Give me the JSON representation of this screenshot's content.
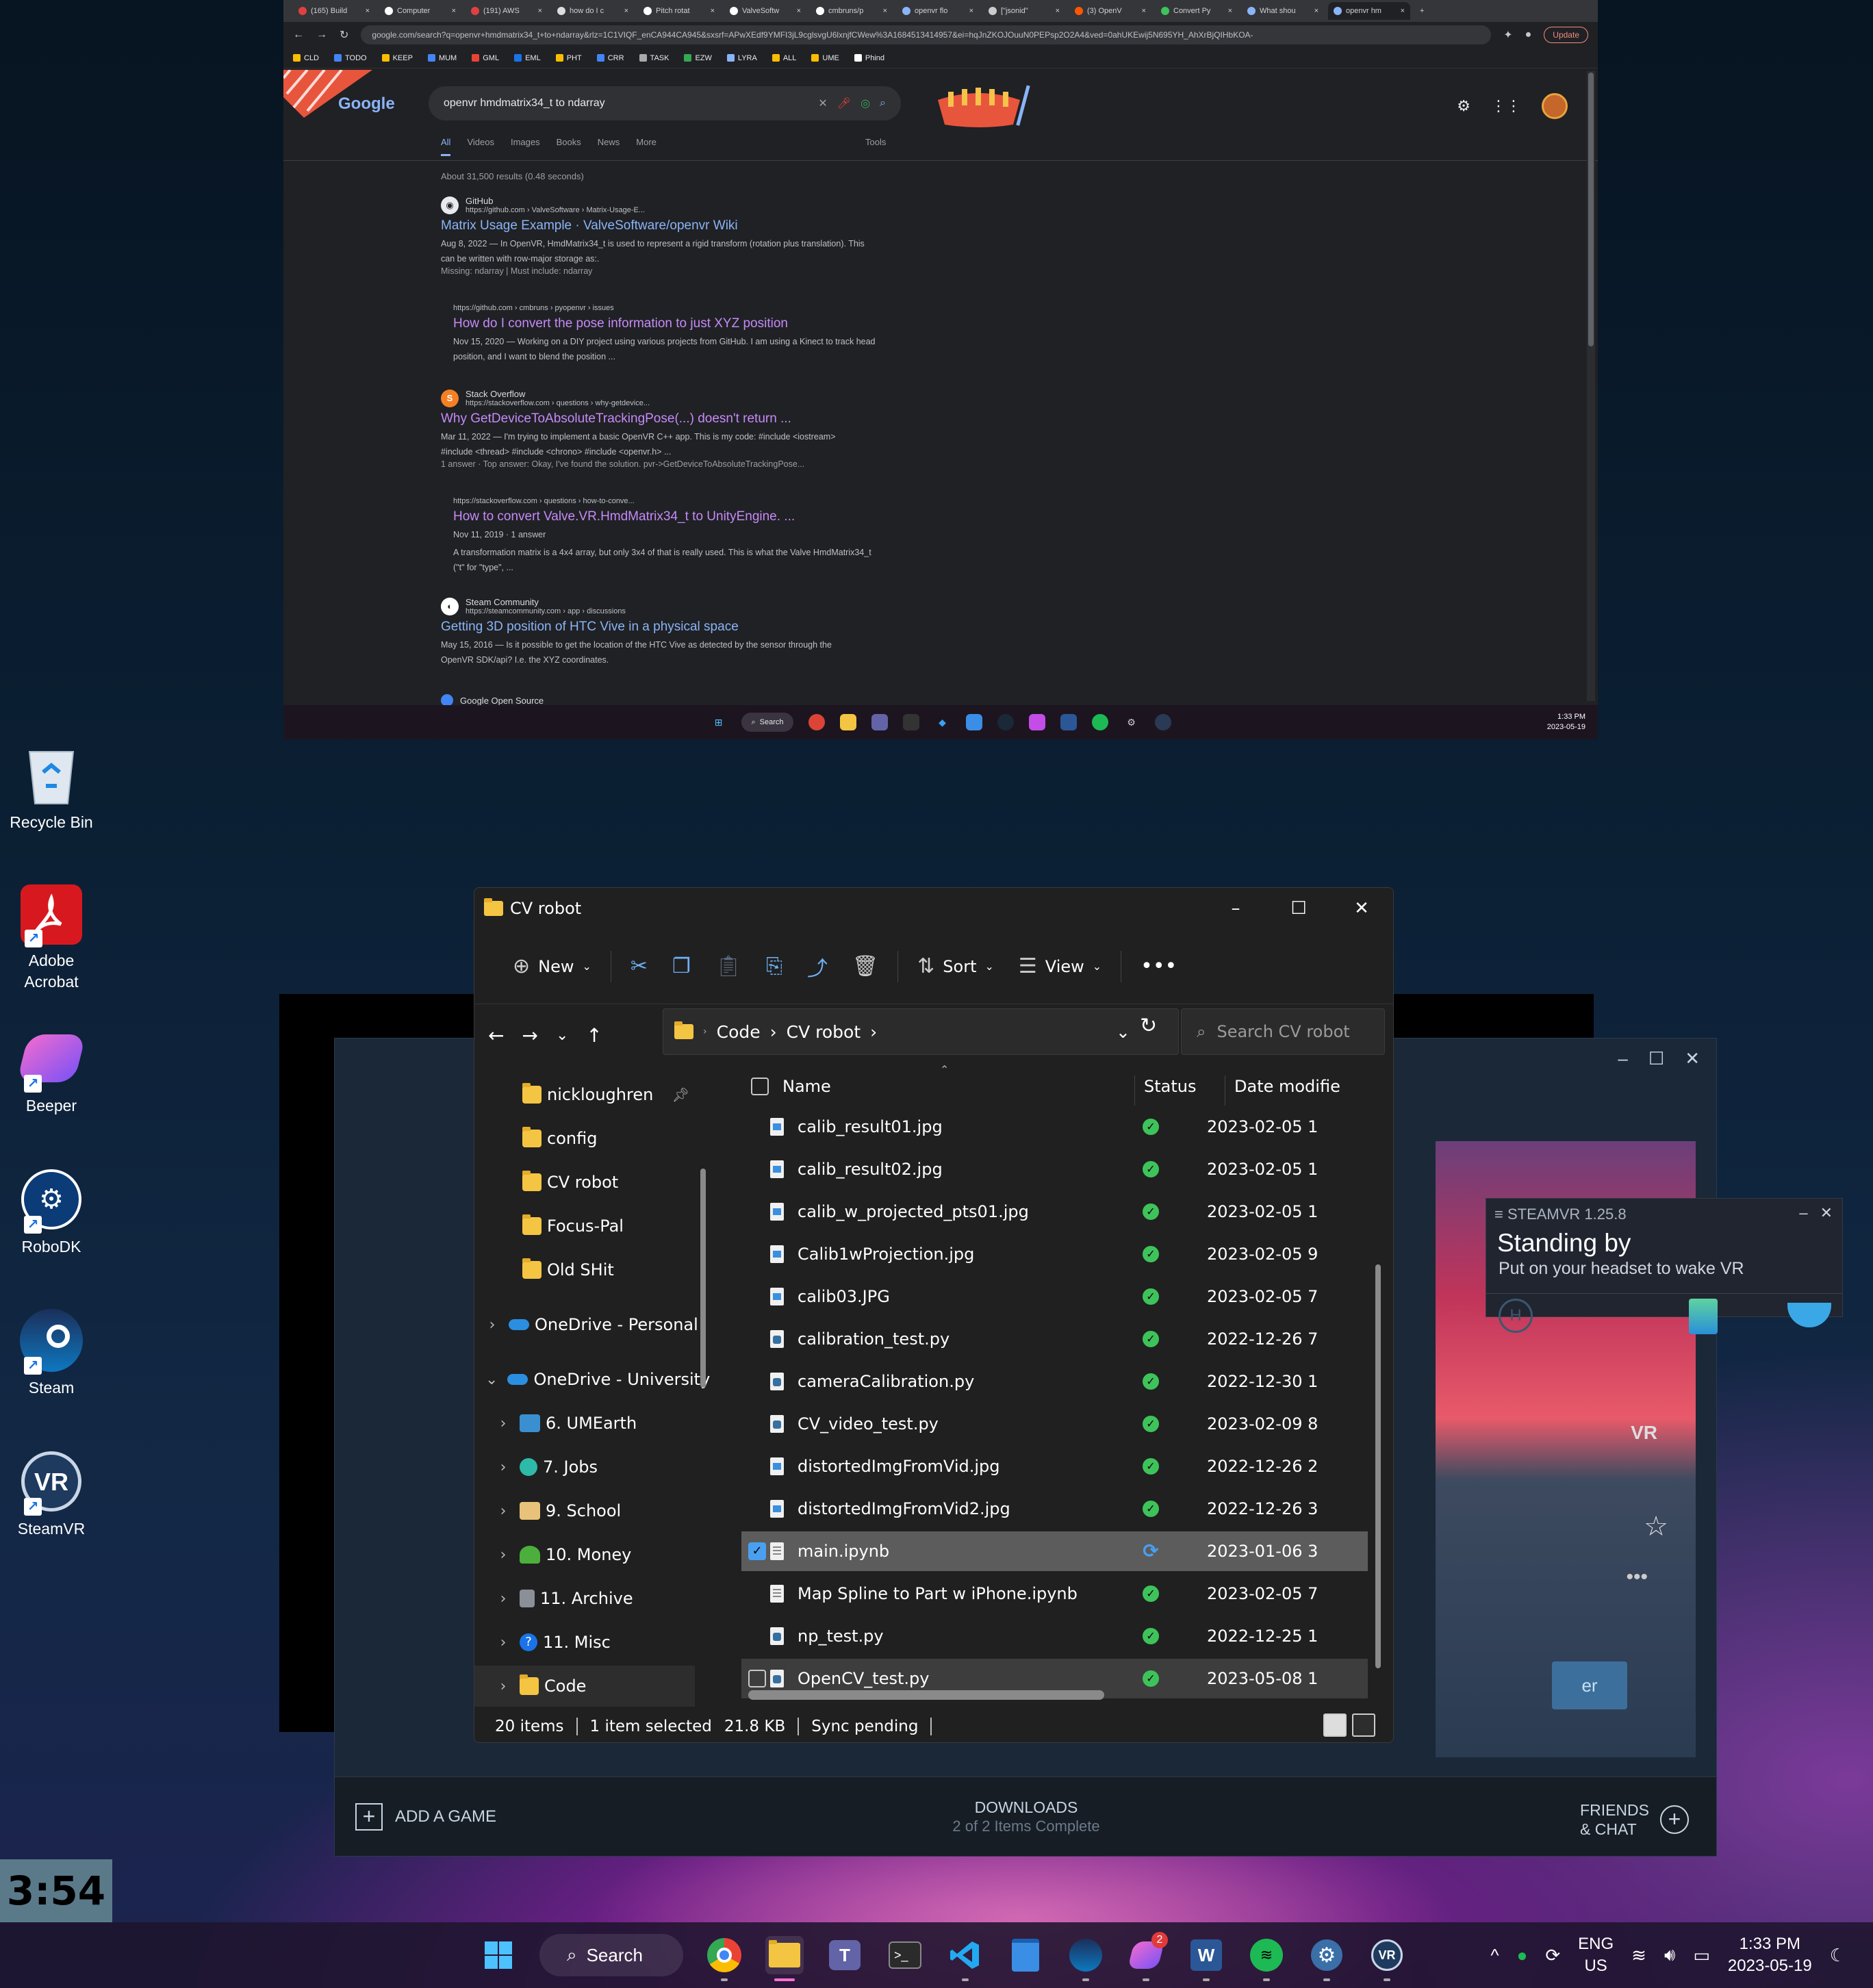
{
  "browser": {
    "tabs": [
      "(165) Build",
      "Computer",
      "(191) AWS",
      "how do I c",
      "Pitch rotat",
      "ValveSoftw",
      "cmbruns/p",
      "openvr flo",
      "[\"jsonid\"",
      "(3) OpenV",
      "Convert Py",
      "What shou",
      "openvr hm"
    ],
    "url": "google.com/search?q=openvr+hmdmatrix34_t+to+ndarray&rlz=1C1VIQF_enCA944CA945&sxsrf=APwXEdf9YMFI3jL9cglsvgU6lxnjfCWew%3A1684513414957&ei=hqJnZKOJOuuN0PEPsp2O2A4&ved=0ahUKEwij5N695YH_AhXrBjQIHbKOA-",
    "update_label": "Update",
    "bookmarks": [
      "CLD",
      "TODO",
      "KEEP",
      "MUM",
      "GML",
      "EML",
      "PHT",
      "CRR",
      "TASK",
      "EZW",
      "LYRA",
      "ALL",
      "UME",
      "Phind"
    ]
  },
  "google": {
    "logo": "Google",
    "query": "openvr hmdmatrix34_t to ndarray",
    "tabs": [
      "All",
      "Videos",
      "Images",
      "Books",
      "News",
      "More"
    ],
    "tools": "Tools",
    "stats": "About 31,500 results (0.48 seconds)",
    "results": [
      {
        "site": "GitHub",
        "url": "https://github.com › ValveSoftware › Matrix-Usage-E...",
        "title": "Matrix Usage Example · ValveSoftware/openvr Wiki",
        "snippet": "Aug 8, 2022 — In OpenVR, HmdMatrix34_t is used to represent a rigid transform (rotation plus translation). This can be written with row-major storage as:.",
        "extra": "Missing: ndarray | Must include: ndarray"
      },
      {
        "url": "https://github.com › cmbruns › pyopenvr › issues",
        "title": "How do I convert the pose information to just XYZ position",
        "snippet": "Nov 15, 2020 — Working on a DIY project using various projects from GitHub. I am using a Kinect to track head position, and I want to blend the position ..."
      },
      {
        "site": "Stack Overflow",
        "url": "https://stackoverflow.com › questions › why-getdevice...",
        "title": "Why GetDeviceToAbsoluteTrackingPose(...) doesn't return ...",
        "snippet": "Mar 11, 2022 — I'm trying to implement a basic OpenVR C++ app. This is my code: #include <iostream> #include <thread> #include <chrono> #include <openvr.h> ...",
        "extra": "1 answer · Top answer: Okay, I've found the solution. pvr->GetDeviceToAbsoluteTrackingPose..."
      },
      {
        "url": "https://stackoverflow.com › questions › how-to-conve...",
        "title": "How to convert Valve.VR.HmdMatrix34_t to UnityEngine. ...",
        "snippet": "Nov 11, 2019 · 1 answer",
        "extra": "A transformation matrix is a 4x4 array, but only 3x4 of that is really used. This is what the Valve HmdMatrix34_t (\"t\" for \"type\", ..."
      },
      {
        "site": "Steam Community",
        "url": "https://steamcommunity.com › app › discussions",
        "title": "Getting 3D position of HTC Vive in a physical space",
        "snippet": "May 15, 2016 — Is it possible to get the location of the HTC Vive as detected by the sensor through the OpenVR SDK/api? I.e. the XYZ coordinates."
      },
      {
        "site": "Google Open Source"
      }
    ],
    "taskbar_search": "Search",
    "time": "1:33 PM",
    "date": "2023-05-19"
  },
  "desktop": {
    "icons": [
      "Recycle Bin",
      "Adobe Acrobat",
      "Beeper",
      "RoboDK",
      "Steam",
      "SteamVR"
    ]
  },
  "explorer": {
    "title": "CV robot",
    "commands": {
      "new": "New",
      "sort": "Sort",
      "view": "View"
    },
    "breadcrumb": [
      "Code",
      "CV robot"
    ],
    "search_placeholder": "Search CV robot",
    "sidebar": [
      "nicklоughren",
      "config",
      "CV robot",
      "Focus-Pal",
      "Old SHit",
      "OneDrive - Personal",
      "OneDrive - University",
      "6. UMEarth",
      "7. Jobs",
      "9. School",
      "10. Money",
      "11. Archive",
      "11. Misc",
      "Code"
    ],
    "columns": {
      "name": "Name",
      "status": "Status",
      "date": "Date modifie"
    },
    "files": [
      {
        "name": "calib_result01.jpg",
        "date": "2023-02-05 1"
      },
      {
        "name": "calib_result02.jpg",
        "date": "2023-02-05 1"
      },
      {
        "name": "calib_w_projected_pts01.jpg",
        "date": "2023-02-05 1"
      },
      {
        "name": "Calib1wProjection.jpg",
        "date": "2023-02-05 9"
      },
      {
        "name": "calib03.JPG",
        "date": "2023-02-05 7"
      },
      {
        "name": "calibration_test.py",
        "date": "2022-12-26 7"
      },
      {
        "name": "cameraCalibration.py",
        "date": "2022-12-30 1"
      },
      {
        "name": "CV_video_test.py",
        "date": "2023-02-09 8"
      },
      {
        "name": "distortedImgFromVid.jpg",
        "date": "2022-12-26 2"
      },
      {
        "name": "distortedImgFromVid2.jpg",
        "date": "2022-12-26 3"
      },
      {
        "name": "main.ipynb",
        "date": "2023-01-06 3"
      },
      {
        "name": "Map Spline to Part w iPhone.ipynb",
        "date": "2023-02-05 7"
      },
      {
        "name": "np_test.py",
        "date": "2022-12-25 1"
      },
      {
        "name": "OpenCV_test.py",
        "date": "2023-05-08 1"
      }
    ],
    "status": {
      "items": "20 items",
      "selected": "1 item selected",
      "size": "21.8 KB",
      "sync": "Sync pending"
    }
  },
  "steam": {
    "vr_label": "VR",
    "play_label": "er",
    "add_game": "ADD A GAME",
    "downloads": "DOWNLOADS",
    "downloads_sub": "2 of 2 Items Complete",
    "friends_1": "FRIENDS",
    "friends_2": "& CHAT"
  },
  "steamvr": {
    "header": "STEAMVR 1.25.8",
    "status": "Standing by",
    "hint": "Put on your headset to wake VR"
  },
  "timer": "3:54",
  "taskbar": {
    "search": "Search",
    "lang_1": "ENG",
    "lang_2": "US",
    "time": "1:33 PM",
    "date": "2023-05-19",
    "badge": "2"
  }
}
